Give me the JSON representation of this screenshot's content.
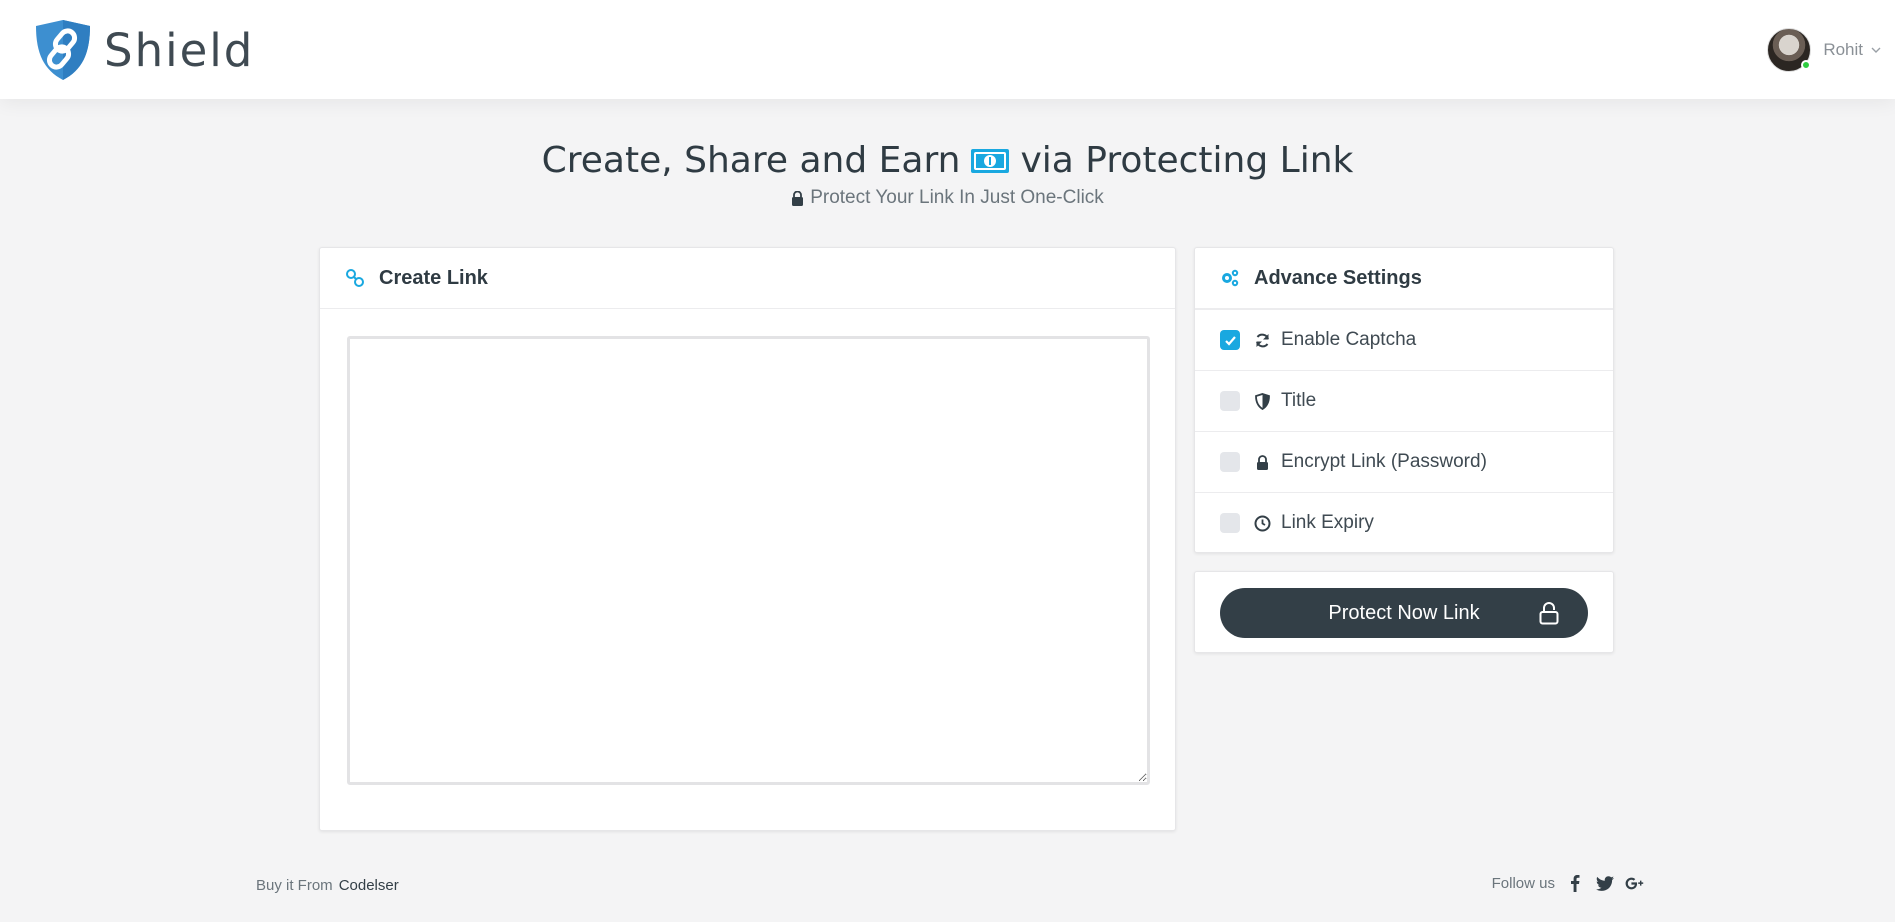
{
  "navbar": {
    "brand_name": "Shield",
    "user_name": "Rohit"
  },
  "hero": {
    "title_before": "Create, Share and Earn",
    "title_after": "via Protecting Link",
    "subtitle": "Protect Your Link In Just One-Click"
  },
  "create_card": {
    "title": "Create Link",
    "textarea_value": ""
  },
  "settings_card": {
    "title": "Advance Settings",
    "items": [
      {
        "label": "Enable Captcha",
        "checked": true,
        "icon": "refresh-icon"
      },
      {
        "label": "Title",
        "checked": false,
        "icon": "shield-icon"
      },
      {
        "label": "Encrypt Link (Password)",
        "checked": false,
        "icon": "lock-icon"
      },
      {
        "label": "Link Expiry",
        "checked": false,
        "icon": "clock-icon"
      }
    ]
  },
  "protect": {
    "button_label": "Protect Now Link"
  },
  "footer": {
    "buy_text": "Buy it From",
    "buy_link": "Codelser",
    "follow_text": "Follow us"
  },
  "colors": {
    "accent": "#19a8e0",
    "dark": "#333f47",
    "background": "#f4f4f5"
  }
}
